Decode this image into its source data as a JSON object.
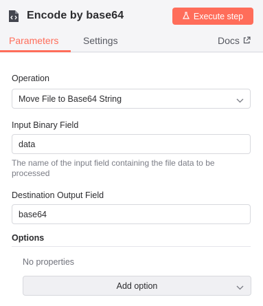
{
  "header": {
    "node_icon": "file-code-icon",
    "title": "Encode by base64",
    "execute_button": {
      "label": "Execute step",
      "icon": "flask-icon"
    },
    "accent_color": "#ff6d5a"
  },
  "tabs": [
    {
      "label": "Parameters",
      "active": true
    },
    {
      "label": "Settings",
      "active": false
    }
  ],
  "docs": {
    "label": "Docs",
    "icon": "external-link-icon"
  },
  "parameters": {
    "operation": {
      "label": "Operation",
      "value": "Move File to Base64 String"
    },
    "input_binary_field": {
      "label": "Input Binary Field",
      "value": "data",
      "hint": "The name of the input field containing the file data to be processed"
    },
    "destination_output_field": {
      "label": "Destination Output Field",
      "value": "base64"
    }
  },
  "options": {
    "label": "Options",
    "empty_text": "No properties",
    "add_button": "Add option"
  }
}
